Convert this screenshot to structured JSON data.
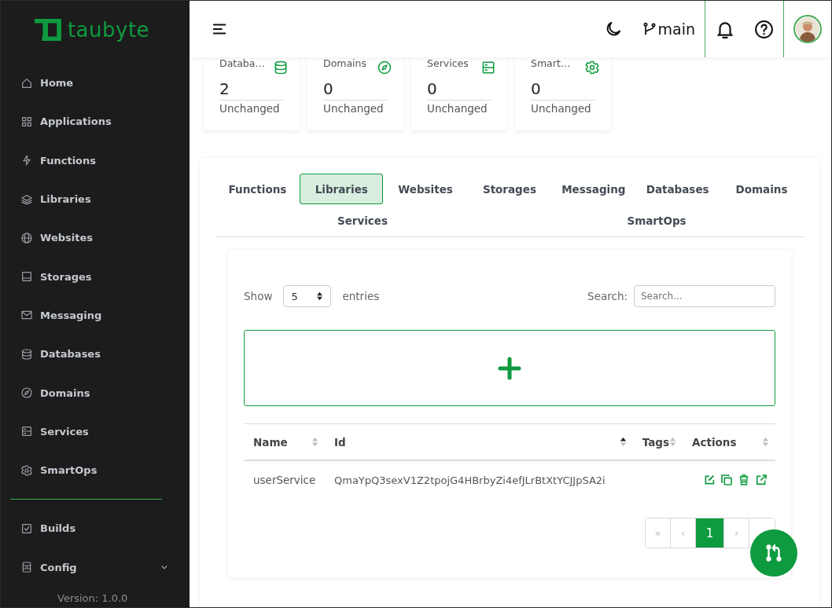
{
  "sidebar": {
    "logo": "taubyte",
    "items": [
      {
        "label": "Home"
      },
      {
        "label": "Applications"
      },
      {
        "label": "Functions"
      },
      {
        "label": "Libraries"
      },
      {
        "label": "Websites"
      },
      {
        "label": "Storages"
      },
      {
        "label": "Messaging"
      },
      {
        "label": "Databases"
      },
      {
        "label": "Domains"
      },
      {
        "label": "Services"
      },
      {
        "label": "SmartOps"
      }
    ],
    "tools": [
      {
        "label": "Builds",
        "expandable": false
      },
      {
        "label": "Config",
        "expandable": true
      }
    ],
    "version": "Version: 1.0.0"
  },
  "header": {
    "branch": "main"
  },
  "stats": [
    {
      "label": "Databa…",
      "value": "2",
      "status": "Unchanged"
    },
    {
      "label": "Domains",
      "value": "0",
      "status": "Unchanged"
    },
    {
      "label": "Services",
      "value": "0",
      "status": "Unchanged"
    },
    {
      "label": "Smart…",
      "value": "0",
      "status": "Unchanged"
    }
  ],
  "tabs": [
    {
      "label": "Functions",
      "selected": false
    },
    {
      "label": "Libraries",
      "selected": true
    },
    {
      "label": "Websites",
      "selected": false
    },
    {
      "label": "Storages",
      "selected": false
    },
    {
      "label": "Messaging",
      "selected": false
    },
    {
      "label": "Databases",
      "selected": false
    },
    {
      "label": "Domains",
      "selected": false
    },
    {
      "label": "Services",
      "selected": false
    },
    {
      "label": "SmartOps",
      "selected": false
    }
  ],
  "table_controls": {
    "show_label": "Show",
    "page_size": "5",
    "entries_label": "entries",
    "search_label": "Search:",
    "search_placeholder": "Search..."
  },
  "table": {
    "columns": [
      {
        "label": "Name",
        "sorted": false
      },
      {
        "label": "Id",
        "sorted": true
      },
      {
        "label": "Tags",
        "sorted": false
      },
      {
        "label": "Actions",
        "sorted": false
      }
    ],
    "rows": [
      {
        "name": "userService",
        "id": "QmaYpQ3sexV1Z2tpojG4HBrbyZi4efJLrBtXtYCJJpSA2i"
      }
    ]
  },
  "pagination": {
    "first": "«",
    "previous": "‹",
    "pages": [
      {
        "label": "1",
        "selected": true
      }
    ],
    "next": "›"
  }
}
